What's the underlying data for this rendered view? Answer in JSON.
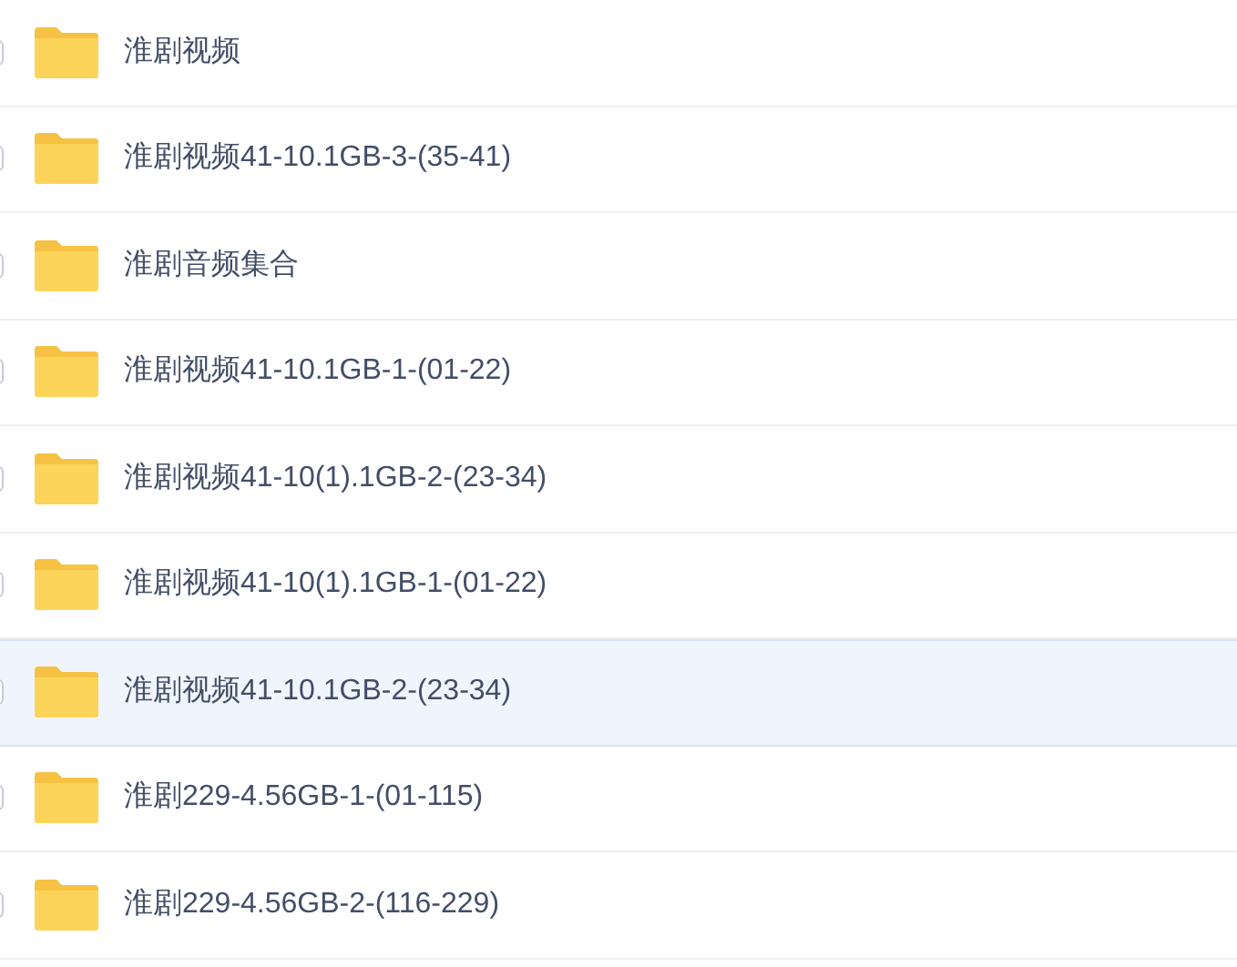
{
  "files": [
    {
      "name": "淮剧视频",
      "hovered": false
    },
    {
      "name": "淮剧视频41-10.1GB-3-(35-41)",
      "hovered": false
    },
    {
      "name": "淮剧音频集合",
      "hovered": false
    },
    {
      "name": "淮剧视频41-10.1GB-1-(01-22)",
      "hovered": false
    },
    {
      "name": "淮剧视频41-10(1).1GB-2-(23-34)",
      "hovered": false
    },
    {
      "name": "淮剧视频41-10(1).1GB-1-(01-22)",
      "hovered": false
    },
    {
      "name": "淮剧视频41-10.1GB-2-(23-34)",
      "hovered": true
    },
    {
      "name": "淮剧229-4.56GB-1-(01-115)",
      "hovered": false
    },
    {
      "name": "淮剧229-4.56GB-2-(116-229)",
      "hovered": false
    }
  ]
}
